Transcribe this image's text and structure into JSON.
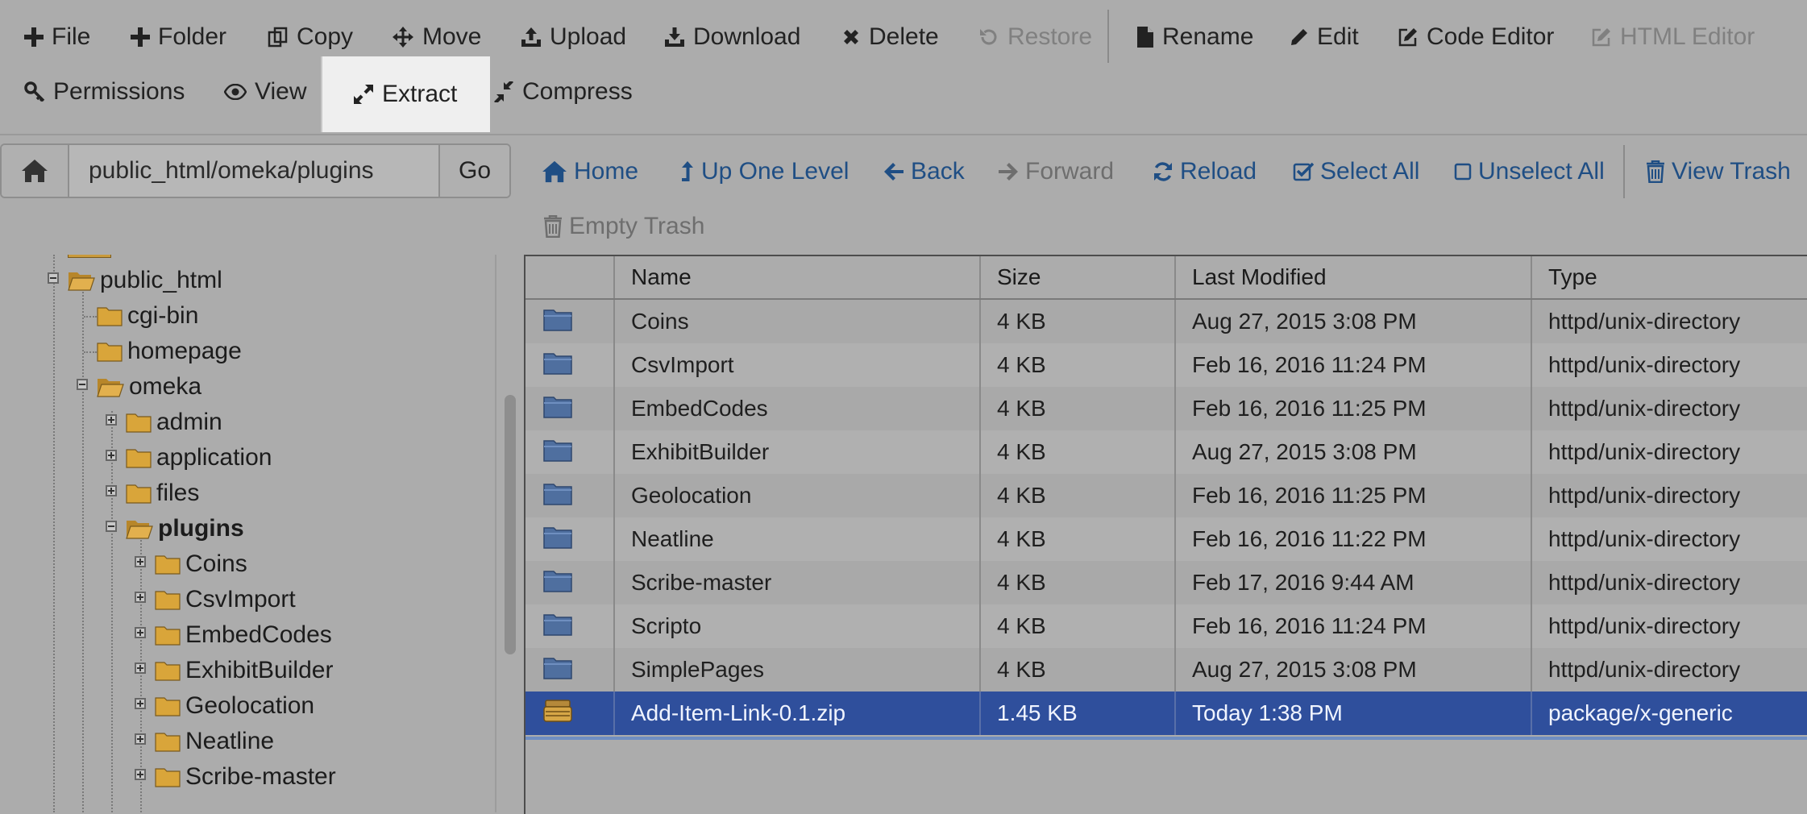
{
  "toolbar": {
    "row1": [
      {
        "key": "file",
        "label": "File",
        "icon": "plus-icon"
      },
      {
        "key": "folder",
        "label": "Folder",
        "icon": "plus-icon"
      },
      {
        "key": "copy",
        "label": "Copy",
        "icon": "copy-icon"
      },
      {
        "key": "move",
        "label": "Move",
        "icon": "move-icon"
      },
      {
        "key": "upload",
        "label": "Upload",
        "icon": "upload-icon"
      },
      {
        "key": "download",
        "label": "Download",
        "icon": "download-icon"
      },
      {
        "key": "delete",
        "label": "Delete",
        "icon": "close-icon"
      },
      {
        "key": "restore",
        "label": "Restore",
        "icon": "restore-icon",
        "disabled": true
      },
      {
        "key": "rename",
        "label": "Rename",
        "icon": "file-icon"
      },
      {
        "key": "edit",
        "label": "Edit",
        "icon": "pencil-icon"
      },
      {
        "key": "code_editor",
        "label": "Code Editor",
        "icon": "edit-square-icon"
      },
      {
        "key": "html_editor",
        "label": "HTML Editor",
        "icon": "edit-square-icon",
        "disabled": true
      }
    ],
    "row2": [
      {
        "key": "permissions",
        "label": "Permissions",
        "icon": "key-icon"
      },
      {
        "key": "view",
        "label": "View",
        "icon": "eye-icon"
      },
      {
        "key": "extract",
        "label": "Extract",
        "icon": "expand-icon",
        "highlighted": true
      },
      {
        "key": "compress",
        "label": "Compress",
        "icon": "compress-icon"
      }
    ]
  },
  "pathbar": {
    "value": "public_html/omeka/plugins",
    "go_label": "Go",
    "home_icon": "home-icon"
  },
  "nav": [
    {
      "key": "home",
      "label": "Home",
      "icon": "home-icon"
    },
    {
      "key": "up",
      "label": "Up One Level",
      "icon": "level-up-icon"
    },
    {
      "key": "back",
      "label": "Back",
      "icon": "arrow-left-icon"
    },
    {
      "key": "forward",
      "label": "Forward",
      "icon": "arrow-right-icon",
      "disabled": true
    },
    {
      "key": "reload",
      "label": "Reload",
      "icon": "refresh-icon"
    },
    {
      "key": "select_all",
      "label": "Select All",
      "icon": "checkbox-checked-icon"
    },
    {
      "key": "unselect_all",
      "label": "Unselect All",
      "icon": "checkbox-empty-icon"
    },
    {
      "key": "view_trash",
      "label": "View Trash",
      "icon": "trash-icon"
    },
    {
      "key": "empty_trash",
      "label": "Empty Trash",
      "icon": "trash-icon",
      "disabled": true
    }
  ],
  "tree": [
    {
      "label": "public_html",
      "open": true
    },
    {
      "label": "cgi-bin"
    },
    {
      "label": "homepage"
    },
    {
      "label": "omeka",
      "open": true
    },
    {
      "label": "admin"
    },
    {
      "label": "application"
    },
    {
      "label": "files"
    },
    {
      "label": "plugins",
      "open": true,
      "current": true
    },
    {
      "label": "Coins"
    },
    {
      "label": "CsvImport"
    },
    {
      "label": "EmbedCodes"
    },
    {
      "label": "ExhibitBuilder"
    },
    {
      "label": "Geolocation"
    },
    {
      "label": "Neatline"
    },
    {
      "label": "Scribe-master"
    }
  ],
  "table": {
    "columns": [
      "Name",
      "Size",
      "Last Modified",
      "Type"
    ],
    "rows": [
      {
        "name": "Coins",
        "size": "4 KB",
        "modified": "Aug 27, 2015 3:08 PM",
        "type": "httpd/unix-directory",
        "icon": "folder-icon"
      },
      {
        "name": "CsvImport",
        "size": "4 KB",
        "modified": "Feb 16, 2016 11:24 PM",
        "type": "httpd/unix-directory",
        "icon": "folder-icon"
      },
      {
        "name": "EmbedCodes",
        "size": "4 KB",
        "modified": "Feb 16, 2016 11:25 PM",
        "type": "httpd/unix-directory",
        "icon": "folder-icon"
      },
      {
        "name": "ExhibitBuilder",
        "size": "4 KB",
        "modified": "Aug 27, 2015 3:08 PM",
        "type": "httpd/unix-directory",
        "icon": "folder-icon"
      },
      {
        "name": "Geolocation",
        "size": "4 KB",
        "modified": "Feb 16, 2016 11:25 PM",
        "type": "httpd/unix-directory",
        "icon": "folder-icon"
      },
      {
        "name": "Neatline",
        "size": "4 KB",
        "modified": "Feb 16, 2016 11:22 PM",
        "type": "httpd/unix-directory",
        "icon": "folder-icon"
      },
      {
        "name": "Scribe-master",
        "size": "4 KB",
        "modified": "Feb 17, 2016 9:44 AM",
        "type": "httpd/unix-directory",
        "icon": "folder-icon"
      },
      {
        "name": "Scripto",
        "size": "4 KB",
        "modified": "Feb 16, 2016 11:24 PM",
        "type": "httpd/unix-directory",
        "icon": "folder-icon"
      },
      {
        "name": "SimplePages",
        "size": "4 KB",
        "modified": "Aug 27, 2015 3:08 PM",
        "type": "httpd/unix-directory",
        "icon": "folder-icon"
      },
      {
        "name": "Add-Item-Link-0.1.zip",
        "size": "1.45 KB",
        "modified": "Today 1:38 PM",
        "type": "package/x-generic",
        "icon": "archive-icon",
        "selected": true
      }
    ]
  },
  "colors": {
    "background": "#acacac",
    "link": "#1f4e84",
    "selected_row": "#2f4f9c",
    "folder": "#d9a53a",
    "table_folder": "#4f6f9f"
  }
}
